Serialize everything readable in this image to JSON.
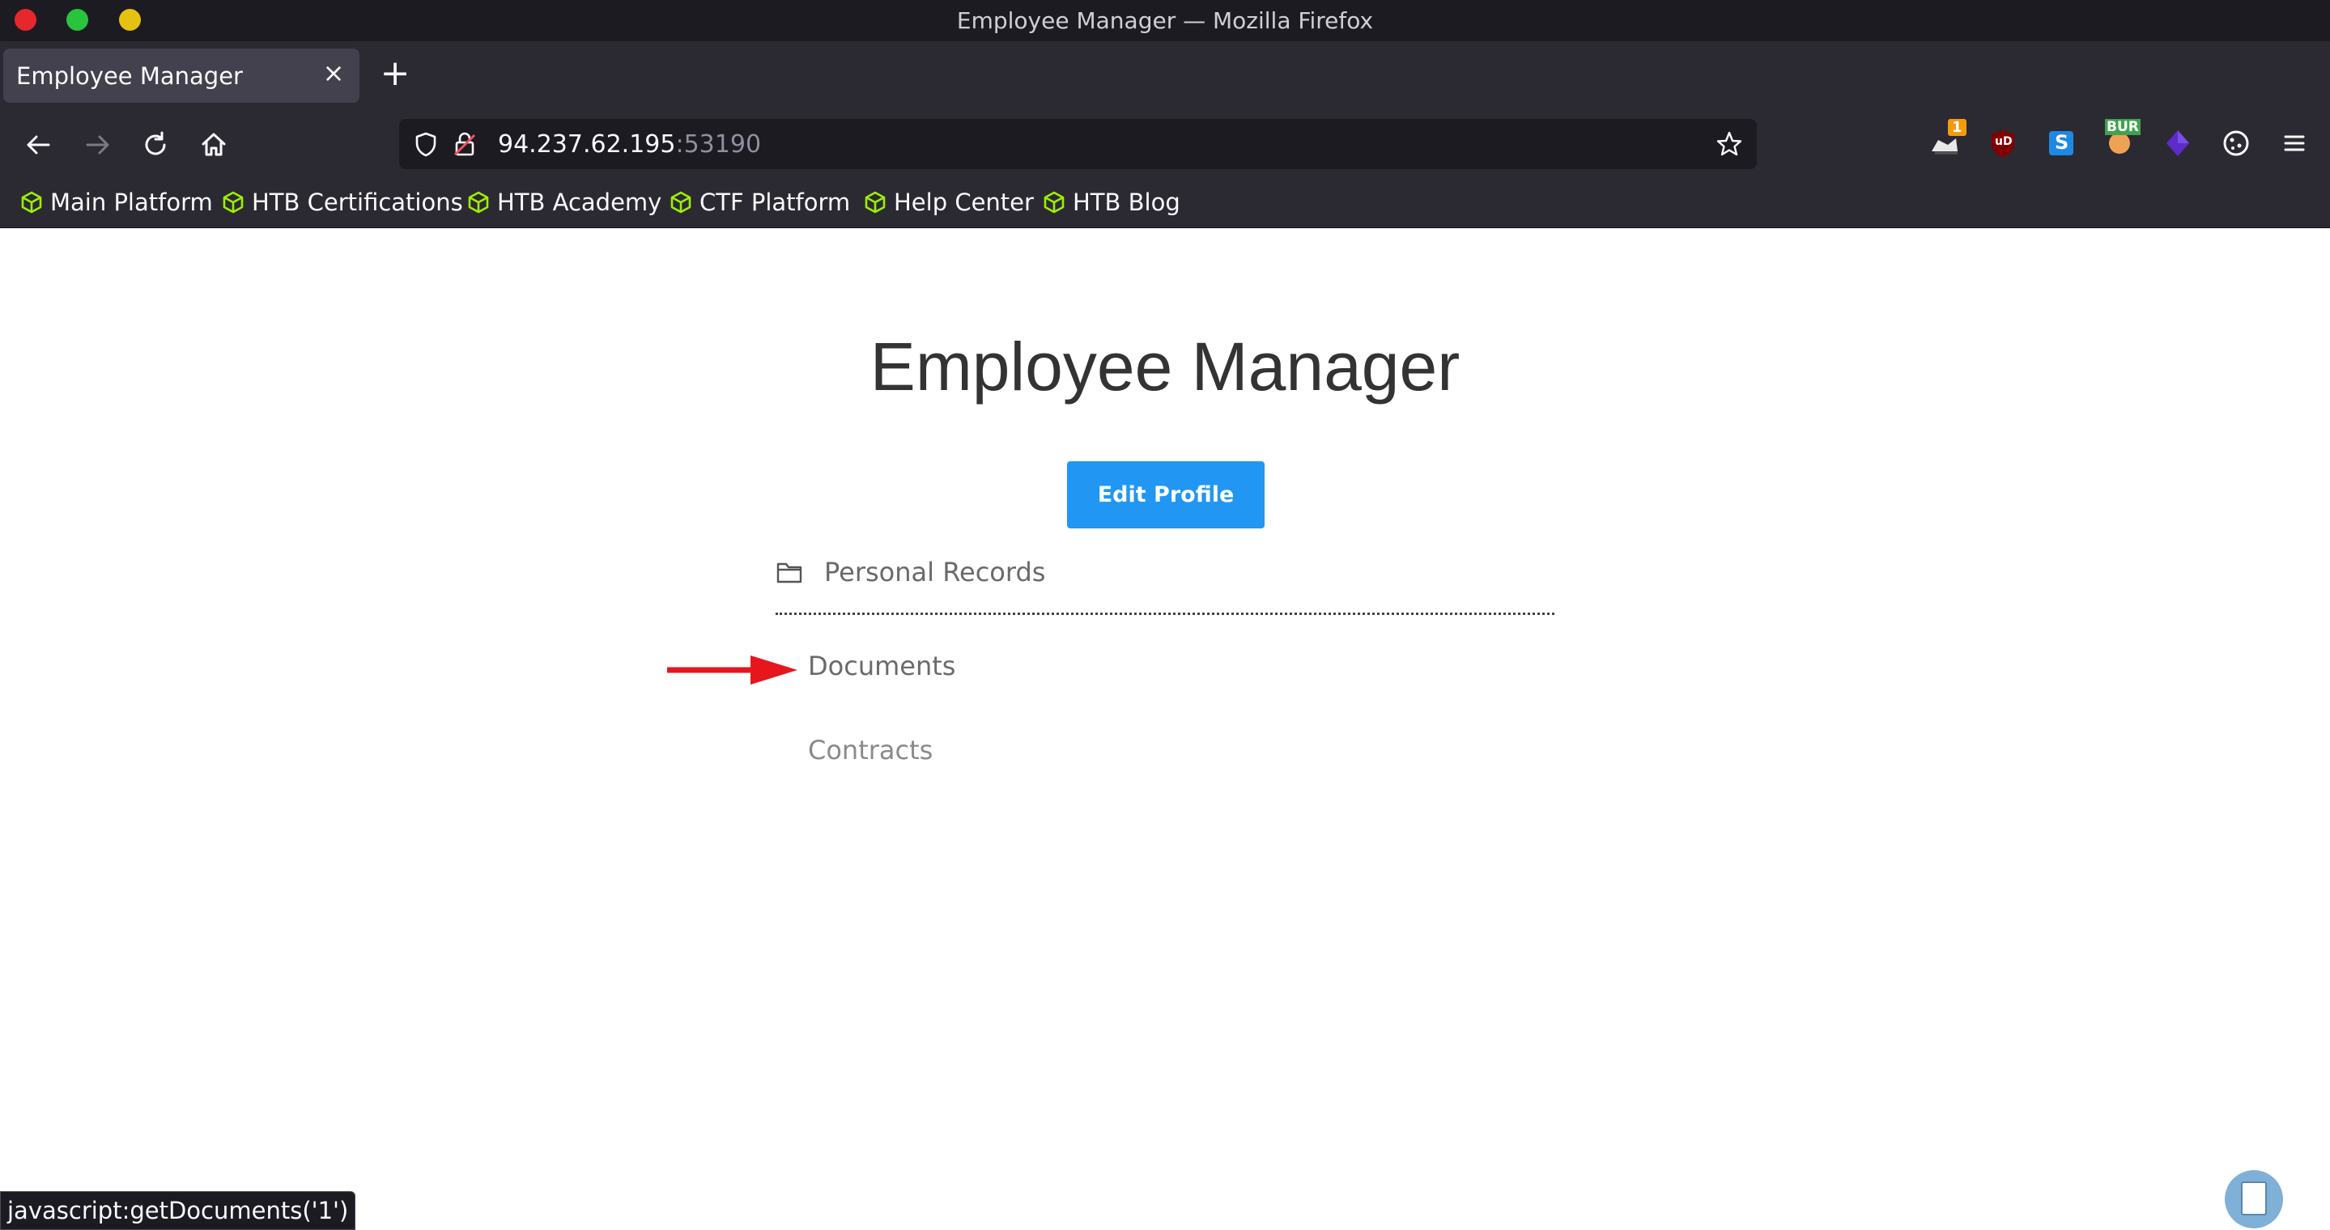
{
  "window": {
    "title": "Employee Manager — Mozilla Firefox"
  },
  "tabs": [
    {
      "title": "Employee Manager",
      "close": "×"
    }
  ],
  "new_tab": "+",
  "address_bar": {
    "host": "94.237.62.195",
    "port": ":53190"
  },
  "bookmarks": [
    {
      "label": "Main Platform"
    },
    {
      "label": "HTB Certifications"
    },
    {
      "label": "HTB Academy"
    },
    {
      "label": "CTF Platform"
    },
    {
      "label": "Help Center"
    },
    {
      "label": "HTB Blog"
    }
  ],
  "extensions": {
    "notification_count": "1",
    "ublock_label": "uD",
    "s_label": "S",
    "burp_label": "BUR"
  },
  "page": {
    "title": "Employee Manager",
    "edit_button": "Edit Profile",
    "records_label": "Personal Records",
    "links": {
      "documents": "Documents",
      "contracts": "Contracts"
    }
  },
  "status_bar": {
    "text": "javascript:getDocuments('1')"
  },
  "colors": {
    "accent": "#2196f3",
    "annotation_arrow": "#e5171c",
    "bookmark_icon": "#9fef00",
    "toolbar_bg": "#2b2a33"
  },
  "icons": {
    "back": "arrow-left-icon",
    "forward": "arrow-right-icon",
    "reload": "reload-icon",
    "home": "home-icon",
    "shield": "shield-icon",
    "lock": "lock-insecure-icon",
    "star": "star-icon",
    "menu": "hamburger-menu-icon",
    "folder": "folder-icon",
    "bookmark": "htb-cube-icon"
  }
}
